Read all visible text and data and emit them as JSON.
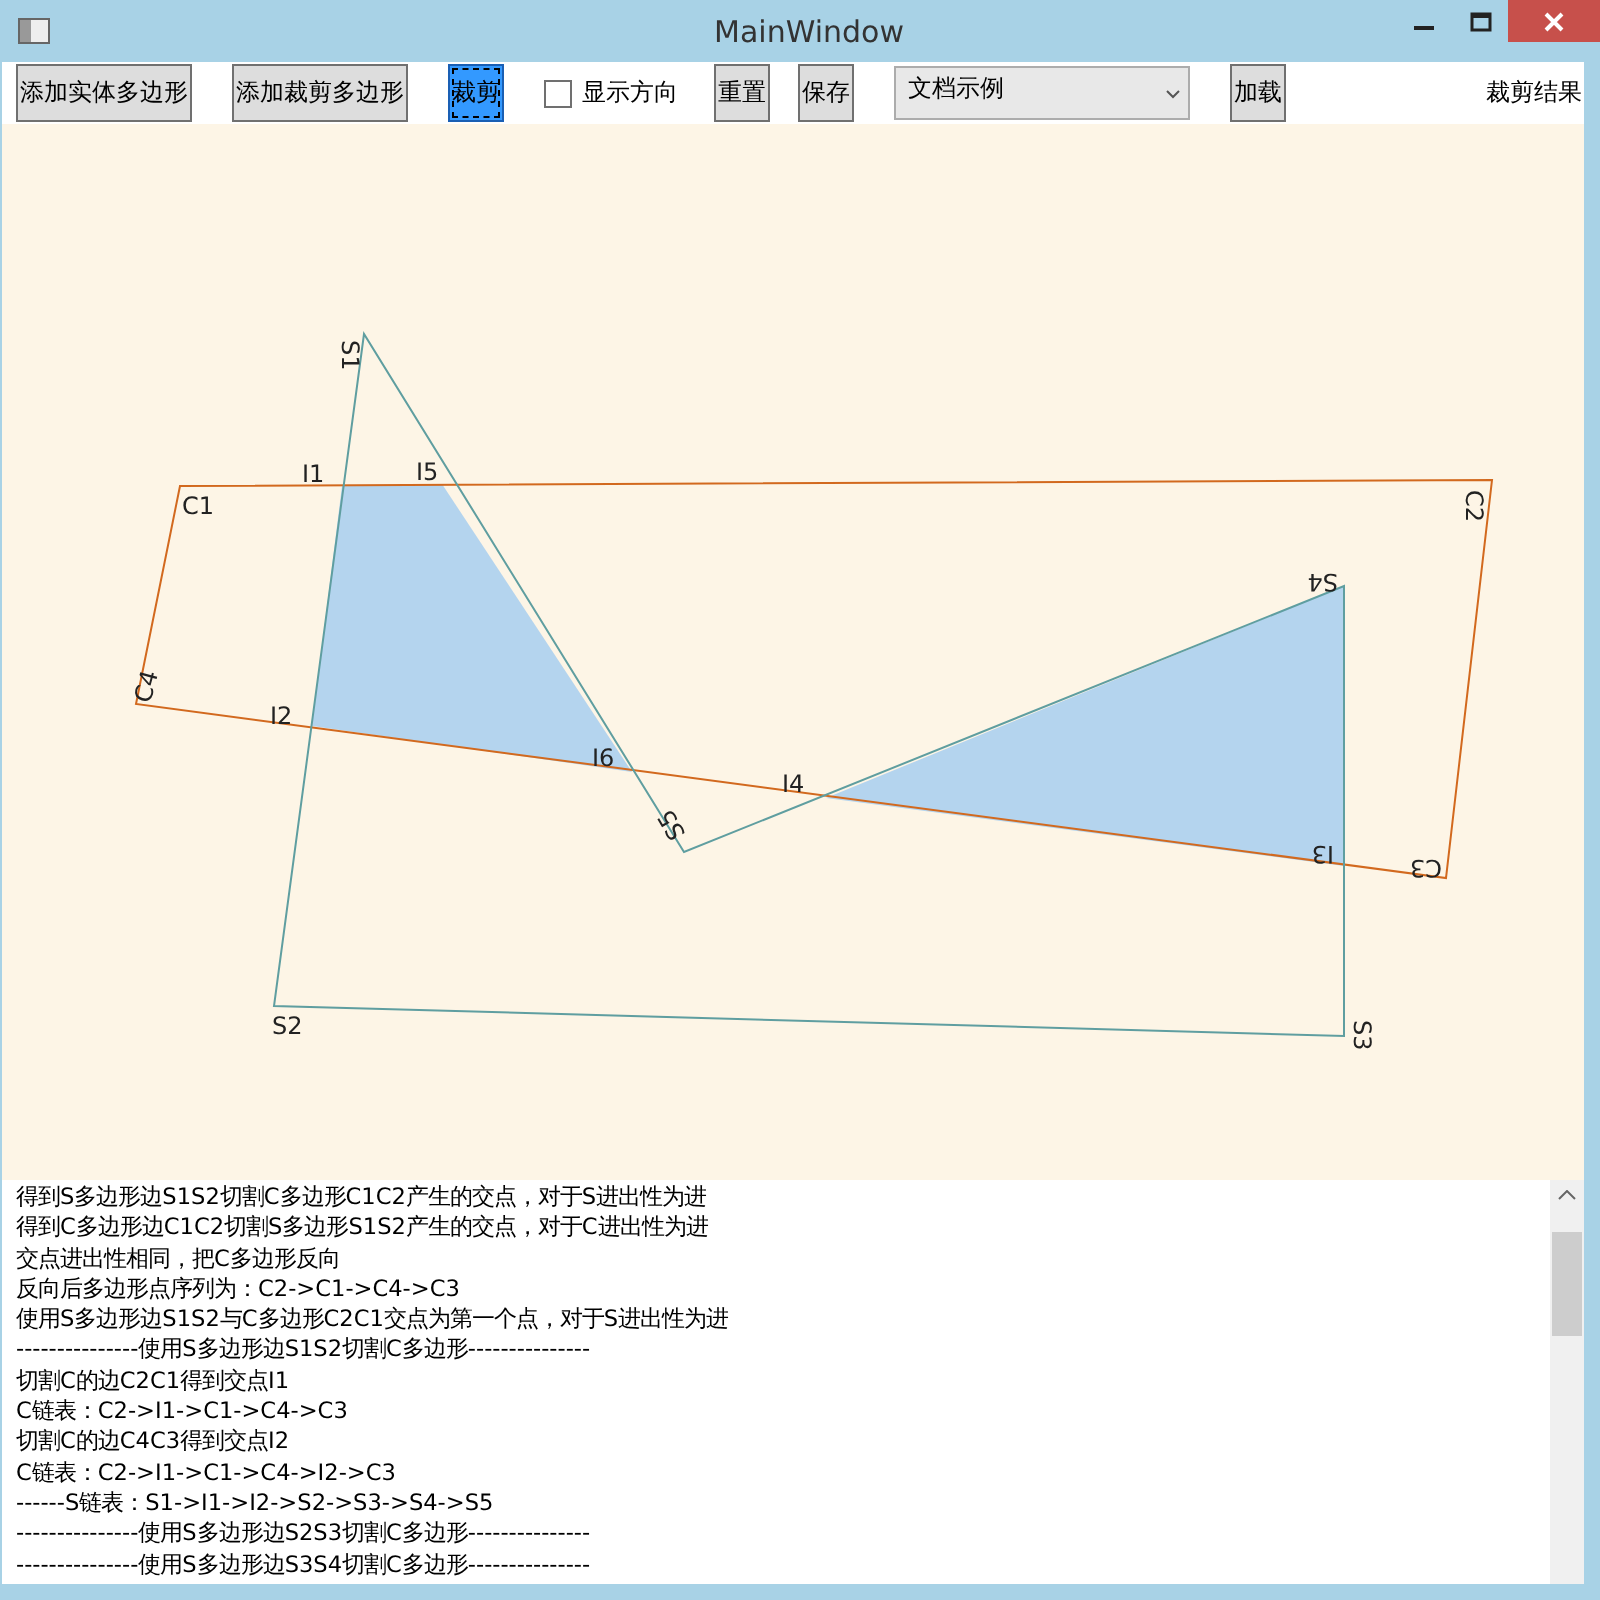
{
  "window": {
    "title": "MainWindow"
  },
  "toolbar": [
    {
      "kind": "button",
      "label": "添加实体多边形",
      "focused": false
    },
    {
      "kind": "button",
      "label": "添加裁剪多边形",
      "focused": false
    },
    {
      "kind": "button",
      "label": "裁剪",
      "focused": true
    },
    {
      "kind": "checkbox",
      "label": "显示方向",
      "checked": false
    },
    {
      "kind": "button",
      "label": "重置",
      "focused": false
    },
    {
      "kind": "button",
      "label": "保存",
      "focused": false
    },
    {
      "kind": "dropdown",
      "label": "文档示例"
    },
    {
      "kind": "button",
      "label": "加载",
      "focused": false
    },
    {
      "kind": "label",
      "label": "裁剪结果"
    }
  ],
  "canvas": {
    "subject_vertex_labels": [
      "S1",
      "S2",
      "S3",
      "S4",
      "S5"
    ],
    "clip_vertex_labels": [
      "C1",
      "C2",
      "C3",
      "C4"
    ],
    "intersection_labels": [
      "I1",
      "I2",
      "I3",
      "I4",
      "I5",
      "I6"
    ]
  },
  "log": [
    "得到S多边形边S1S2切割C多边形C1C2产生的交点，对于S进出性为进",
    "得到C多边形边C1C2切割S多边形S1S2产生的交点，对于C进出性为进",
    "交点进出性相同，把C多边形反向",
    "反向后多边形点序列为：C2->C1->C4->C3",
    "使用S多边形边S1S2与C多边形C2C1交点为第一个点，对于S进出性为进",
    "---------------使用S多边形边S1S2切割C多边形---------------",
    "切割C的边C2C1得到交点I1",
    "C链表：C2->I1->C1->C4->C3",
    "切割C的边C4C3得到交点I2",
    "C链表：C2->I1->C1->C4->I2->C3",
    "------S链表：S1->I1->I2->S2->S3->S4->S5",
    "---------------使用S多边形边S2S3切割C多边形---------------",
    "---------------使用S多边形边S3S4切割C多边形---------------"
  ]
}
